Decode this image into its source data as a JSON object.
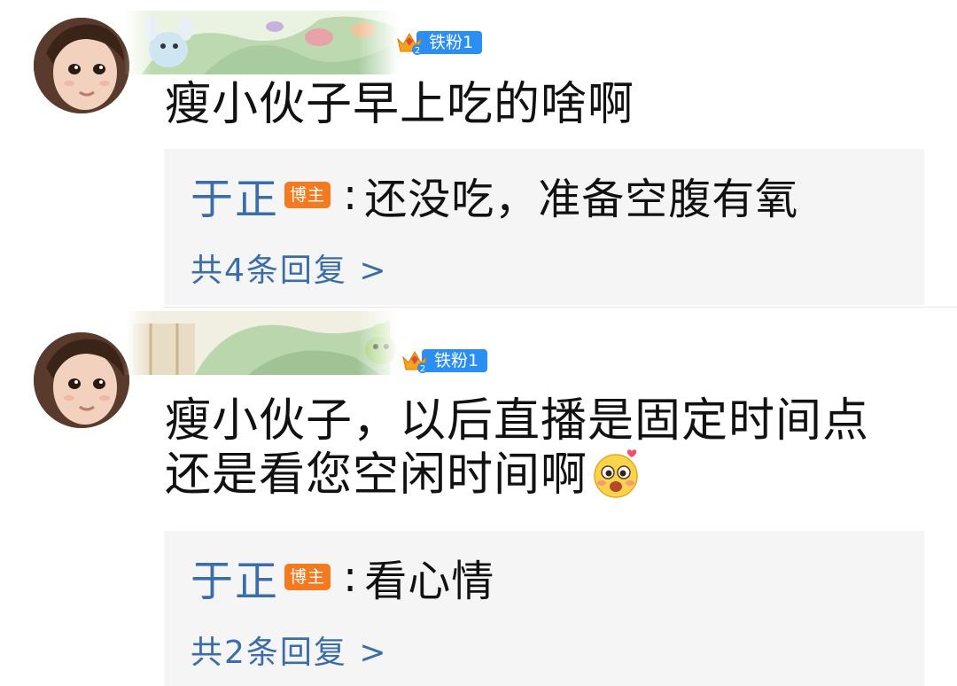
{
  "comments": [
    {
      "fan_badge": "铁粉1",
      "text": "瘦小伙子早上吃的啥啊",
      "reply": {
        "author": "于正",
        "badge": "博主",
        "colon": ":",
        "text": "还没吃，准备空腹有氧"
      },
      "more_replies": "共4条回复 >"
    },
    {
      "fan_badge": "铁粉1",
      "text_line1": "瘦小伙子，以后直播是固定时间点",
      "text_line2": "还是看您空闲时间啊",
      "emoji": "laughing-face-emoji",
      "reply": {
        "author": "于正",
        "badge": "博主",
        "colon": ":",
        "text": "看心情"
      },
      "more_replies": "共2条回复 >"
    }
  ],
  "colors": {
    "link_blue": "#3b6ea8",
    "fan_badge_blue": "#2a8ef3",
    "blogger_badge_orange": "#f47a1f",
    "reply_bg": "#f5f5f5"
  }
}
